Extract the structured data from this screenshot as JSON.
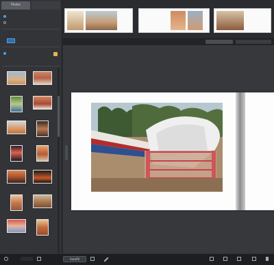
{
  "sidebar": {
    "tabs": [
      {
        "label": "Photos"
      },
      {
        "label": ""
      }
    ],
    "photos": [
      {
        "label": ""
      },
      {
        "label": ""
      },
      {
        "label": ""
      },
      {
        "label": ""
      },
      {
        "label": ""
      },
      {
        "label": ""
      },
      {
        "label": ""
      },
      {
        "label": ""
      },
      {
        "label": ""
      },
      {
        "label": ""
      },
      {
        "label": ""
      },
      {
        "label": ""
      },
      {
        "label": ""
      },
      {
        "label": ""
      }
    ]
  },
  "statusbar": {
    "button_label": "Autofill"
  },
  "colors": {
    "accent_blue": "#4aa3e8",
    "accent_yellow": "#e6b450",
    "panel_bg": "#323438",
    "canvas_bg": "#36383c"
  },
  "icons": [
    "chevron-down-icon",
    "layout-icon",
    "pencil-icon",
    "grid-icon",
    "page-icon",
    "settings-icon",
    "zoom-icon"
  ]
}
